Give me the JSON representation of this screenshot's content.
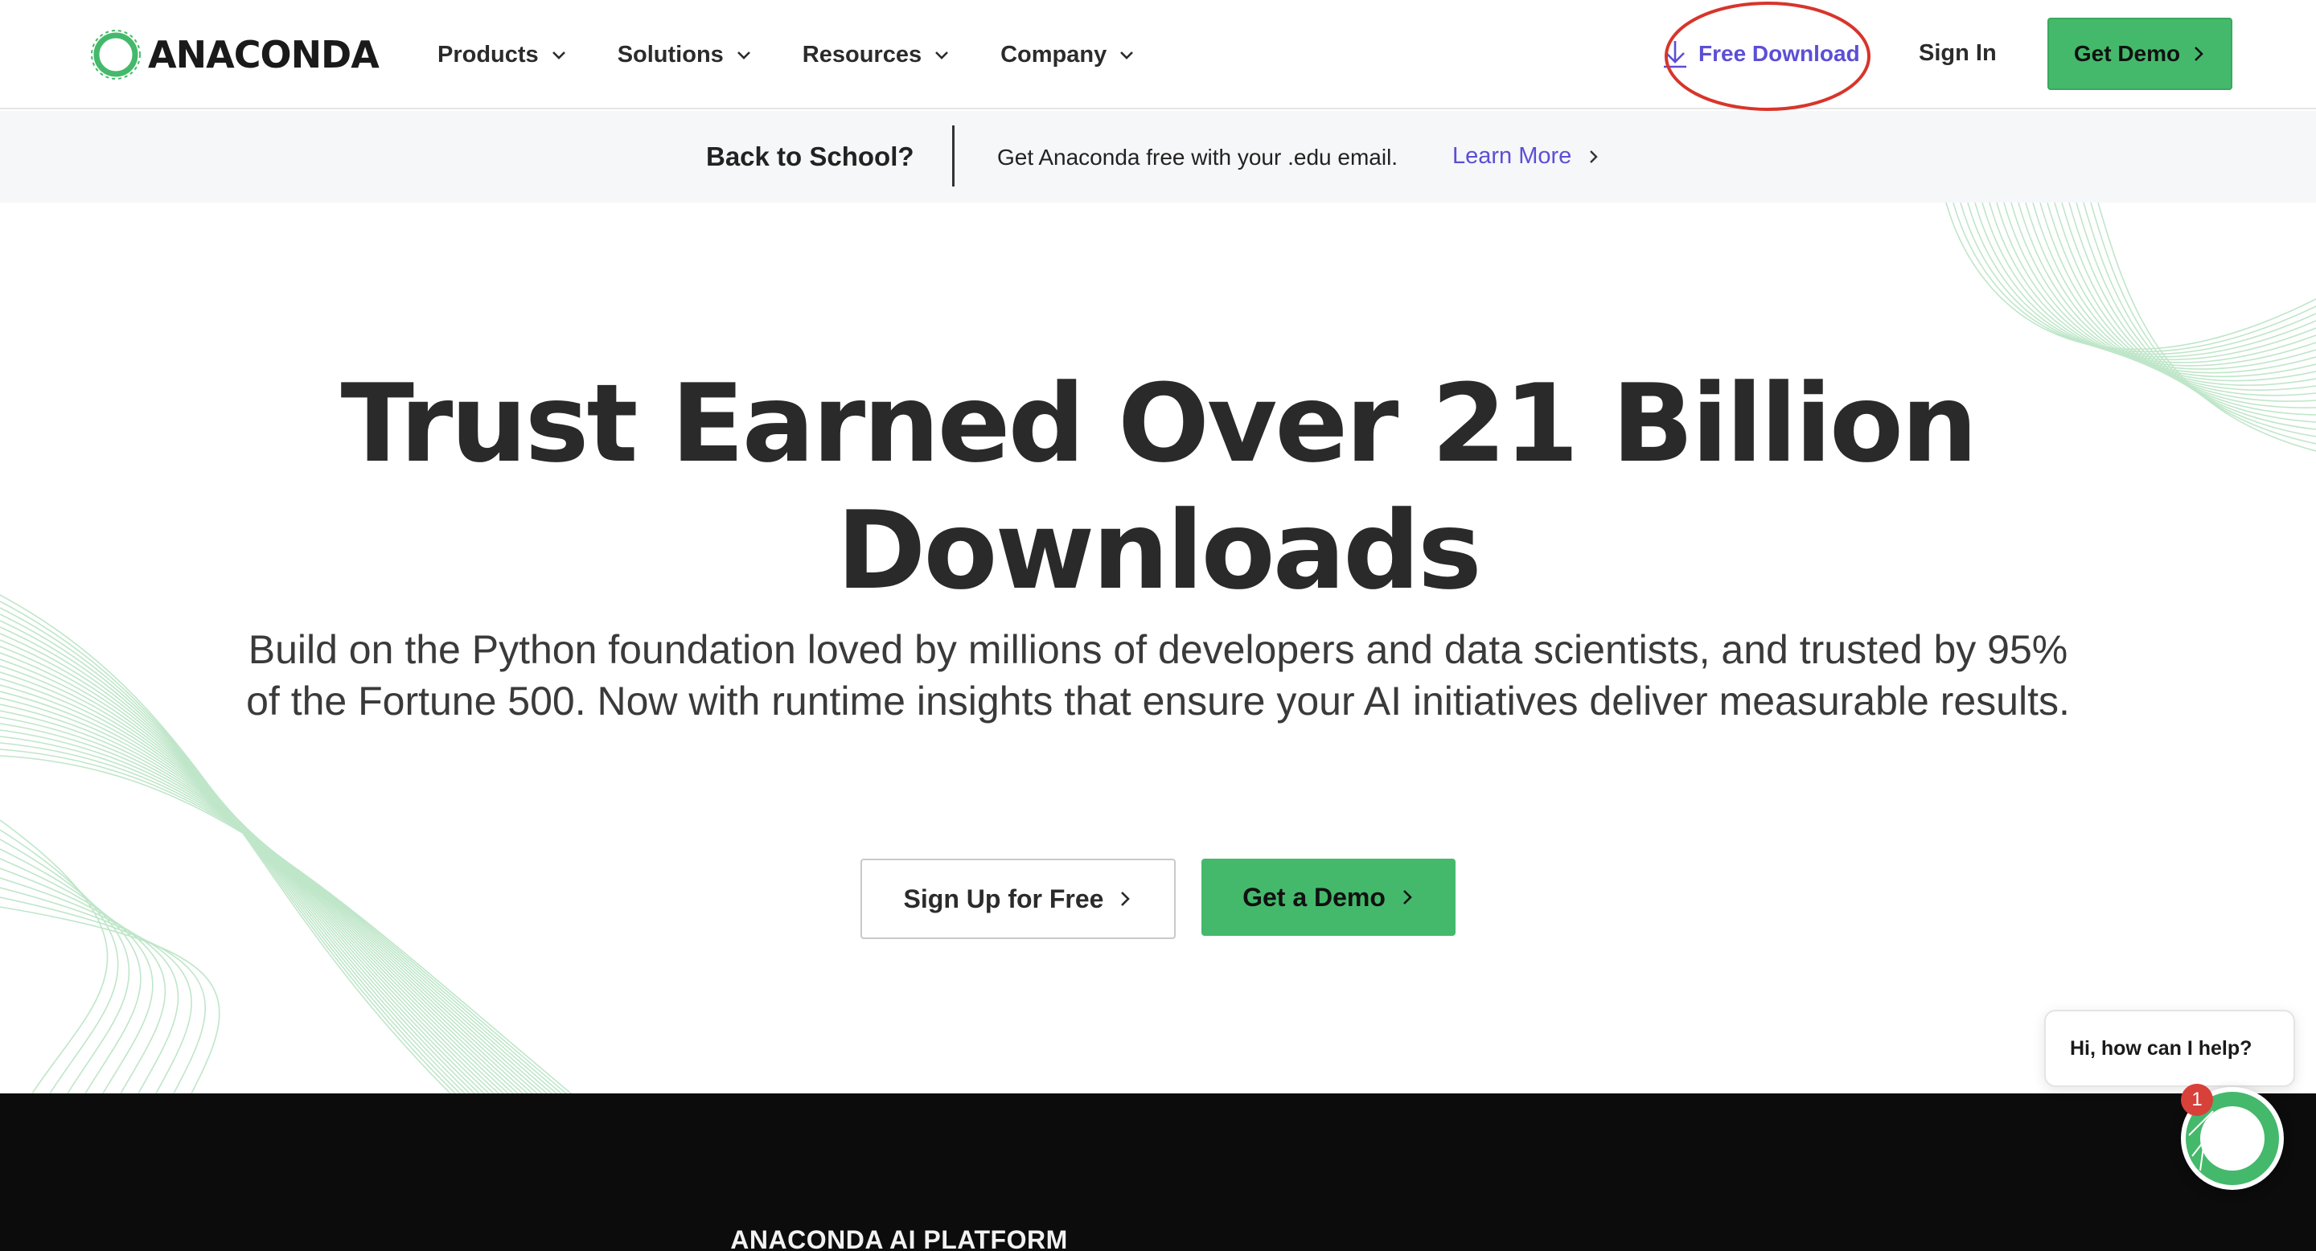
{
  "header": {
    "logo_text": "ANACONDA",
    "nav": [
      {
        "label": "Products"
      },
      {
        "label": "Solutions"
      },
      {
        "label": "Resources"
      },
      {
        "label": "Company"
      }
    ],
    "free_download_label": "Free Download",
    "sign_in_label": "Sign In",
    "get_demo_label": "Get Demo"
  },
  "banner": {
    "title": "Back to School?",
    "text": "Get Anaconda free with your .edu email.",
    "link_label": "Learn More"
  },
  "hero": {
    "title_line1": "Trust Earned Over 21 Billion",
    "title_line2": "Downloads",
    "subtitle": "Build on the Python foundation loved by millions of developers and data scientists, and trusted by 95% of the Fortune 500. Now with runtime insights that ensure your AI initiatives deliver measurable results.",
    "signup_label": "Sign Up for Free",
    "demo_label": "Get a Demo"
  },
  "platform": {
    "label": "ANACONDA AI PLATFORM"
  },
  "chat": {
    "prompt": "Hi, how can I help?",
    "badge_count": "1"
  },
  "colors": {
    "brand_green": "#44b96b",
    "link_purple": "#5b4fd6",
    "annotation_red": "#d8352b",
    "dark_bg": "#0c0c0c"
  },
  "icons": {
    "logo": "anaconda-logo-icon",
    "dropdown": "chevron-down-icon",
    "download": "download-icon",
    "arrow": "chevron-right-icon"
  }
}
